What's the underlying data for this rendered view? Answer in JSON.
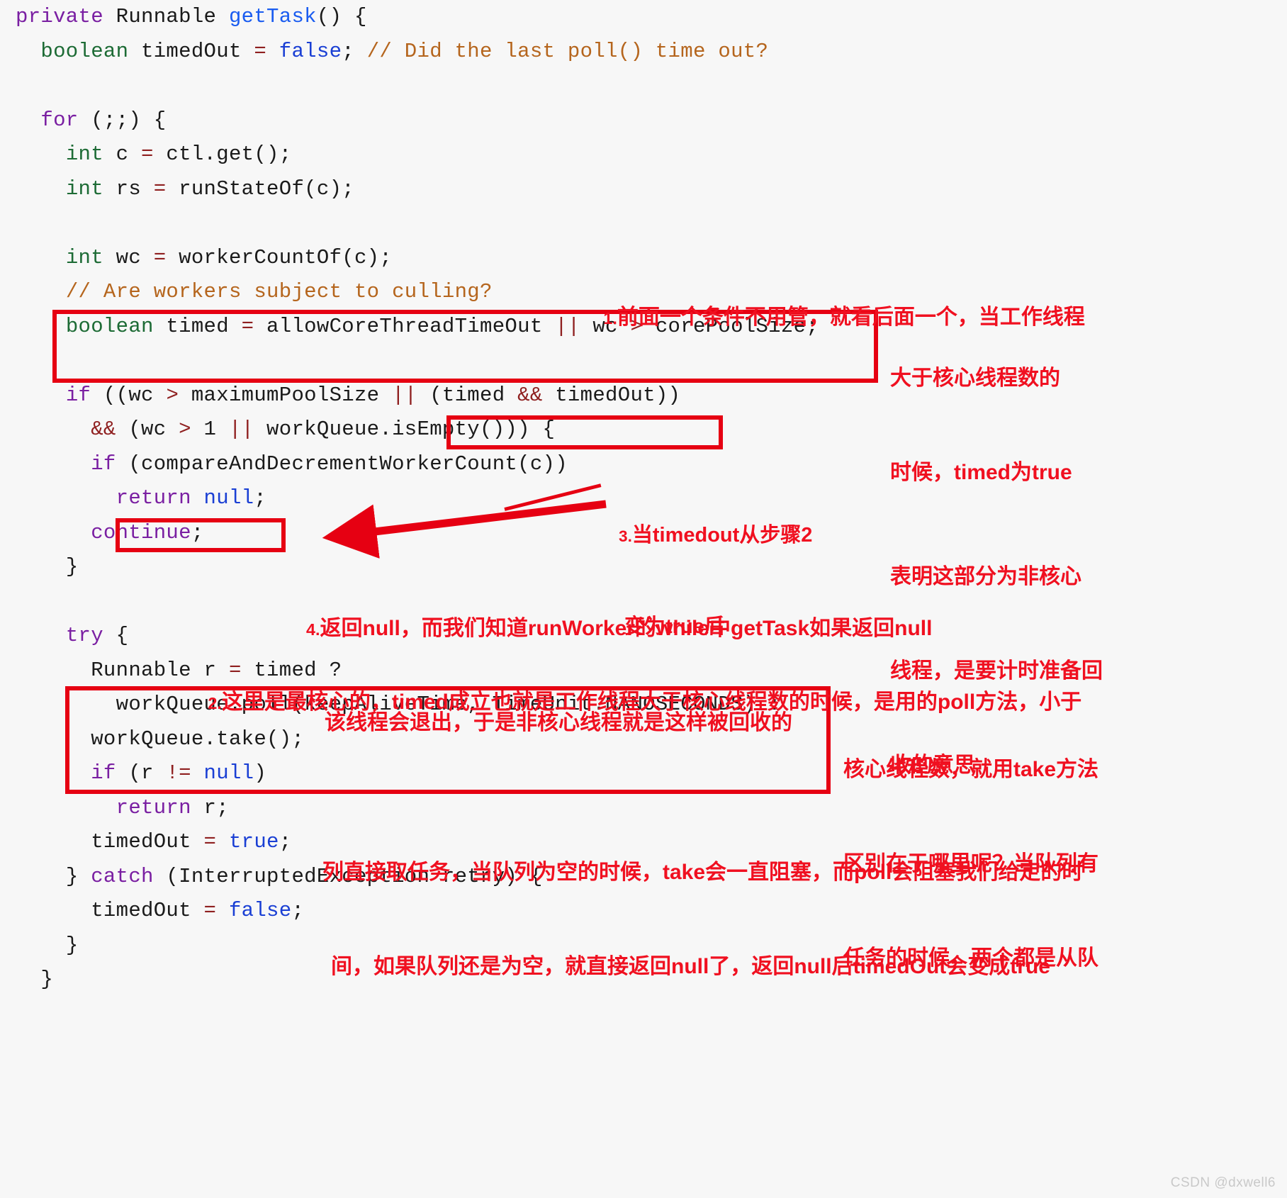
{
  "page": {
    "background": "#f7f7f7",
    "watermark": "CSDN @dxwell6",
    "accent_red": "#e60012",
    "note_red": "#f01020"
  },
  "code": {
    "language": "java",
    "lines": [
      {
        "id": "l1",
        "indent": 0,
        "tokens": [
          {
            "t": "private",
            "c": "kw"
          },
          {
            "t": " ",
            "c": "plain"
          },
          {
            "t": "Runnable",
            "c": "plain"
          },
          {
            "t": " ",
            "c": "plain"
          },
          {
            "t": "getTask",
            "c": "fn"
          },
          {
            "t": "() {",
            "c": "plain"
          }
        ]
      },
      {
        "id": "l2",
        "indent": 1,
        "tokens": [
          {
            "t": "boolean",
            "c": "type"
          },
          {
            "t": " timedOut ",
            "c": "plain"
          },
          {
            "t": "=",
            "c": "op"
          },
          {
            "t": " ",
            "c": "plain"
          },
          {
            "t": "false",
            "c": "lit"
          },
          {
            "t": "; ",
            "c": "plain"
          },
          {
            "t": "// Did the last poll() time out?",
            "c": "cmt"
          }
        ]
      },
      {
        "id": "l3",
        "indent": 0,
        "tokens": [
          {
            "t": "",
            "c": "plain"
          }
        ]
      },
      {
        "id": "l4",
        "indent": 1,
        "tokens": [
          {
            "t": "for",
            "c": "kw"
          },
          {
            "t": " (;;) {",
            "c": "plain"
          }
        ]
      },
      {
        "id": "l5",
        "indent": 2,
        "tokens": [
          {
            "t": "int",
            "c": "type"
          },
          {
            "t": " c ",
            "c": "plain"
          },
          {
            "t": "=",
            "c": "op"
          },
          {
            "t": " ctl.get();",
            "c": "plain"
          }
        ]
      },
      {
        "id": "l6",
        "indent": 2,
        "tokens": [
          {
            "t": "int",
            "c": "type"
          },
          {
            "t": " rs ",
            "c": "plain"
          },
          {
            "t": "=",
            "c": "op"
          },
          {
            "t": " runStateOf(c);",
            "c": "plain"
          }
        ]
      },
      {
        "id": "l7",
        "indent": 0,
        "tokens": [
          {
            "t": "",
            "c": "plain"
          }
        ]
      },
      {
        "id": "l8",
        "indent": 2,
        "tokens": [
          {
            "t": "int",
            "c": "type"
          },
          {
            "t": " wc ",
            "c": "plain"
          },
          {
            "t": "=",
            "c": "op"
          },
          {
            "t": " workerCountOf(c);",
            "c": "plain"
          }
        ]
      },
      {
        "id": "l9",
        "indent": 2,
        "tokens": [
          {
            "t": "// Are workers subject to culling?",
            "c": "cmt"
          }
        ]
      },
      {
        "id": "l10",
        "indent": 2,
        "tokens": [
          {
            "t": "boolean",
            "c": "type"
          },
          {
            "t": " timed ",
            "c": "plain"
          },
          {
            "t": "=",
            "c": "op"
          },
          {
            "t": " allowCoreThreadTimeOut ",
            "c": "plain"
          },
          {
            "t": "||",
            "c": "op"
          },
          {
            "t": " wc ",
            "c": "plain"
          },
          {
            "t": ">",
            "c": "op"
          },
          {
            "t": " corePoolSize;",
            "c": "plain"
          }
        ]
      },
      {
        "id": "l11",
        "indent": 0,
        "tokens": [
          {
            "t": "",
            "c": "plain"
          }
        ]
      },
      {
        "id": "l12",
        "indent": 2,
        "tokens": [
          {
            "t": "if",
            "c": "kw"
          },
          {
            "t": " ((wc ",
            "c": "plain"
          },
          {
            "t": ">",
            "c": "op"
          },
          {
            "t": " maximumPoolSize ",
            "c": "plain"
          },
          {
            "t": "||",
            "c": "op"
          },
          {
            "t": " (timed ",
            "c": "plain"
          },
          {
            "t": "&&",
            "c": "op"
          },
          {
            "t": " timedOut))",
            "c": "plain"
          }
        ]
      },
      {
        "id": "l13",
        "indent": 3,
        "tokens": [
          {
            "t": "&&",
            "c": "op"
          },
          {
            "t": " (wc ",
            "c": "plain"
          },
          {
            "t": ">",
            "c": "op"
          },
          {
            "t": " 1 ",
            "c": "plain"
          },
          {
            "t": "||",
            "c": "op"
          },
          {
            "t": " workQueue.isEmpty())) {",
            "c": "plain"
          }
        ]
      },
      {
        "id": "l14",
        "indent": 3,
        "tokens": [
          {
            "t": "if",
            "c": "kw"
          },
          {
            "t": " (compareAndDecrementWorkerCount(c))",
            "c": "plain"
          }
        ]
      },
      {
        "id": "l15",
        "indent": 4,
        "tokens": [
          {
            "t": "return",
            "c": "kw"
          },
          {
            "t": " ",
            "c": "plain"
          },
          {
            "t": "null",
            "c": "lit"
          },
          {
            "t": ";",
            "c": "plain"
          }
        ]
      },
      {
        "id": "l16",
        "indent": 3,
        "tokens": [
          {
            "t": "continue",
            "c": "kw"
          },
          {
            "t": ";",
            "c": "plain"
          }
        ]
      },
      {
        "id": "l17",
        "indent": 2,
        "tokens": [
          {
            "t": "}",
            "c": "plain"
          }
        ]
      },
      {
        "id": "l18",
        "indent": 0,
        "tokens": [
          {
            "t": "",
            "c": "plain"
          }
        ]
      },
      {
        "id": "l19",
        "indent": 2,
        "tokens": [
          {
            "t": "try",
            "c": "kw"
          },
          {
            "t": " {",
            "c": "plain"
          }
        ]
      },
      {
        "id": "l20",
        "indent": 3,
        "tokens": [
          {
            "t": "Runnable r ",
            "c": "plain"
          },
          {
            "t": "=",
            "c": "op"
          },
          {
            "t": " timed ",
            "c": "plain"
          },
          {
            "t": "?",
            "c": "plain"
          }
        ]
      },
      {
        "id": "l21",
        "indent": 4,
        "tokens": [
          {
            "t": "workQueue.poll(keepAliveTime, TimeUnit.NANOSECONDS) :",
            "c": "plain"
          }
        ]
      },
      {
        "id": "l22",
        "indent": 3,
        "tokens": [
          {
            "t": "workQueue.take();",
            "c": "plain"
          }
        ]
      },
      {
        "id": "l23",
        "indent": 3,
        "tokens": [
          {
            "t": "if",
            "c": "kw"
          },
          {
            "t": " (r ",
            "c": "plain"
          },
          {
            "t": "!=",
            "c": "op"
          },
          {
            "t": " ",
            "c": "plain"
          },
          {
            "t": "null",
            "c": "lit"
          },
          {
            "t": ")",
            "c": "plain"
          }
        ]
      },
      {
        "id": "l24",
        "indent": 4,
        "tokens": [
          {
            "t": "return",
            "c": "kw"
          },
          {
            "t": " r;",
            "c": "plain"
          }
        ]
      },
      {
        "id": "l25",
        "indent": 3,
        "tokens": [
          {
            "t": "timedOut ",
            "c": "plain"
          },
          {
            "t": "=",
            "c": "op"
          },
          {
            "t": " ",
            "c": "plain"
          },
          {
            "t": "true",
            "c": "lit"
          },
          {
            "t": ";",
            "c": "plain"
          }
        ]
      },
      {
        "id": "l26",
        "indent": 2,
        "tokens": [
          {
            "t": "} ",
            "c": "plain"
          },
          {
            "t": "catch",
            "c": "kw"
          },
          {
            "t": " (InterruptedException retry) {",
            "c": "plain"
          }
        ]
      },
      {
        "id": "l27",
        "indent": 3,
        "tokens": [
          {
            "t": "timedOut ",
            "c": "plain"
          },
          {
            "t": "=",
            "c": "op"
          },
          {
            "t": " ",
            "c": "plain"
          },
          {
            "t": "false",
            "c": "lit"
          },
          {
            "t": ";",
            "c": "plain"
          }
        ]
      },
      {
        "id": "l28",
        "indent": 2,
        "tokens": [
          {
            "t": "}",
            "c": "plain"
          }
        ]
      },
      {
        "id": "l29",
        "indent": 1,
        "tokens": [
          {
            "t": "}",
            "c": "plain"
          }
        ]
      }
    ]
  },
  "annotations": {
    "boxes": [
      {
        "id": "box-timed-decl",
        "label": "highlight-box-timed-declaration"
      },
      {
        "id": "box-timedout-cond",
        "label": "highlight-box-timed-and-timedout"
      },
      {
        "id": "box-return-null",
        "label": "highlight-box-return-null"
      },
      {
        "id": "box-poll-take",
        "label": "highlight-box-poll-take"
      }
    ],
    "notes": [
      {
        "id": "note-1",
        "number": "1.",
        "lines": [
          "前面一个条件不用管，就看后面一个，当工作线程"
        ]
      },
      {
        "id": "note-1b",
        "number": "",
        "lines": [
          "大于核心线程数的",
          "时候，timed为true",
          "",
          "表明这部分为非核心",
          "线程，是要计时准备回",
          "收的意思"
        ]
      },
      {
        "id": "note-3",
        "number": "3.",
        "lines": [
          "当timedout从步骤2",
          "变为true后"
        ]
      },
      {
        "id": "note-4",
        "number": "4.",
        "lines": [
          "返回null，而我们知道runWorker的while中getTask如果返回null",
          "该线程会退出，于是非核心线程就是这样被回收的"
        ]
      },
      {
        "id": "note-2",
        "number": "2.",
        "lines": [
          "这里是最核心的，timed成立也就是工作线程大于核心线程数的时候，是用的poll方法，小于"
        ]
      },
      {
        "id": "note-2b",
        "number": "",
        "lines": [
          "核心线程数，就用take方法",
          "区别在于哪里呢？当队列有",
          "任务的时候，两个都是从队"
        ]
      },
      {
        "id": "note-2c",
        "number": "",
        "lines": [
          "列直接取任务，当队列为空的时候，take会一直阻塞，而poll会阻塞我们给定的时",
          "间，如果队列还是为空，就直接返回null了，返回null后timedOut会变成true"
        ]
      }
    ],
    "strikethrough_target": "compareAndDecrementWorkerCount(c))",
    "arrow": {
      "from_label": "note-3",
      "to_label": "box-return-null"
    }
  }
}
